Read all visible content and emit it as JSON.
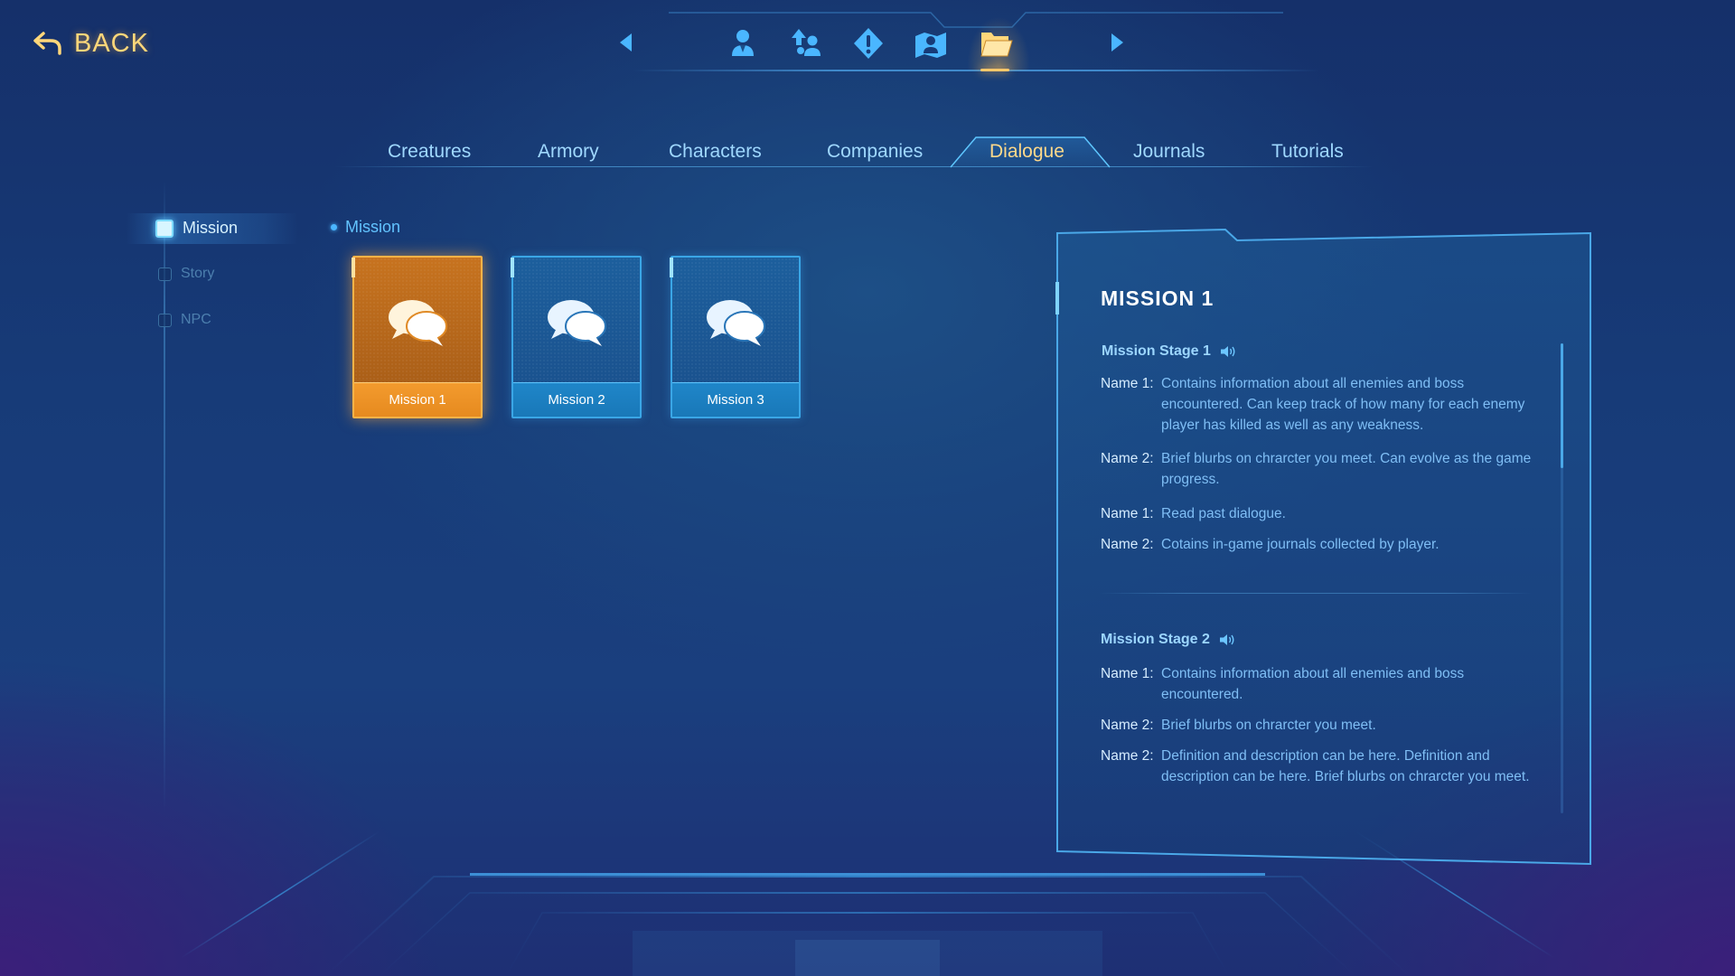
{
  "header": {
    "back_label": "BACK",
    "top_icons": [
      {
        "name": "character-icon"
      },
      {
        "name": "party-upgrade-icon"
      },
      {
        "name": "alert-icon"
      },
      {
        "name": "map-icon"
      },
      {
        "name": "folder-icon",
        "active": true
      }
    ]
  },
  "tabs": [
    {
      "label": "Creatures"
    },
    {
      "label": "Armory"
    },
    {
      "label": "Characters"
    },
    {
      "label": "Companies"
    },
    {
      "label": "Dialogue",
      "active": true
    },
    {
      "label": "Journals"
    },
    {
      "label": "Tutorials"
    }
  ],
  "sidebar": {
    "items": [
      {
        "label": "Mission",
        "active": true
      },
      {
        "label": "Story"
      },
      {
        "label": "NPC"
      }
    ]
  },
  "section": {
    "heading": "Mission"
  },
  "cards": [
    {
      "label": "Mission 1",
      "selected": true
    },
    {
      "label": "Mission 2"
    },
    {
      "label": "Mission 3"
    }
  ],
  "panel": {
    "title": "MISSION 1",
    "stages": [
      {
        "title": "Mission Stage 1",
        "entries": [
          {
            "speaker": "Name 1:",
            "text": "Contains information about all enemies and boss encountered. Can keep track of how many for each enemy player has killed as well as any weakness."
          },
          {
            "speaker": "Name 2:",
            "text": "Brief blurbs on chrarcter you meet. Can evolve as the game progress."
          },
          {
            "speaker": "Name 1:",
            "text": "Read past dialogue."
          },
          {
            "speaker": "Name 2:",
            "text": "Cotains in-game journals collected by player."
          }
        ]
      },
      {
        "title": "Mission Stage 2",
        "entries": [
          {
            "speaker": "Name 1:",
            "text": "Contains information about all enemies and boss encountered."
          },
          {
            "speaker": "Name 2:",
            "text": "Brief blurbs on chrarcter you meet."
          },
          {
            "speaker": "Name 2:",
            "text": "Definition and description can be here. Definition and description can be here. Brief blurbs on chrarcter you meet."
          }
        ]
      }
    ]
  },
  "colors": {
    "accent_blue": "#4ab6ff",
    "accent_gold": "#ffb347",
    "text_blue": "#7fbef5",
    "background": "#173b78"
  }
}
